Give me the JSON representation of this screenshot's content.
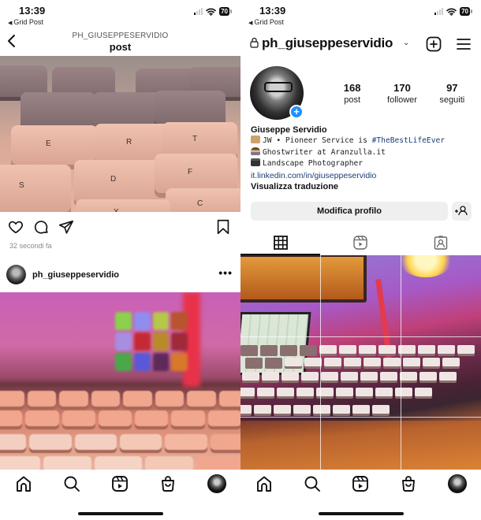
{
  "left": {
    "status_bar": {
      "time": "13:39",
      "back_app": "Grid Post",
      "battery": "70"
    },
    "header": {
      "subtitle": "PH_GIUSEPPESERVIDIO",
      "title": "post"
    },
    "post": {
      "icons": [
        "heart-icon",
        "comment-icon",
        "share-icon",
        "bookmark-icon"
      ],
      "time_ago": "32 secondi fa"
    },
    "next_post": {
      "username": "ph_giuseppeservidio",
      "more": "•••"
    },
    "photo1_keys": [
      "E",
      "R",
      "T",
      "S",
      "D",
      "F",
      "C",
      "X"
    ],
    "bottom_nav": [
      "home-icon",
      "search-icon",
      "reels-icon",
      "shop-icon",
      "profile-avatar"
    ]
  },
  "right": {
    "status_bar": {
      "time": "13:39",
      "back_app": "Grid Post",
      "battery": "70"
    },
    "header": {
      "username": "ph_giuseppeservidio",
      "chevron": "⌄"
    },
    "stats": [
      {
        "value": "168",
        "label": "post"
      },
      {
        "value": "170",
        "label": "follower"
      },
      {
        "value": "97",
        "label": "seguiti"
      }
    ],
    "bio": {
      "name": "Giuseppe Servidio",
      "line1_prefix": "JW • Pioneer Service is ",
      "line1_hashtag": "#TheBestLifeEver",
      "line2": "Ghostwriter at Aranzulla.it",
      "line3": "Landscape Photographer",
      "link": "it.linkedin.com/in/giuseppeservidio",
      "translate": "Visualizza traduzione"
    },
    "buttons": {
      "edit_profile": "Modifica profilo"
    },
    "tabs": [
      "grid-icon",
      "reels-icon",
      "tagged-icon"
    ],
    "active_tab": "grid",
    "avatar_badge": "+"
  }
}
